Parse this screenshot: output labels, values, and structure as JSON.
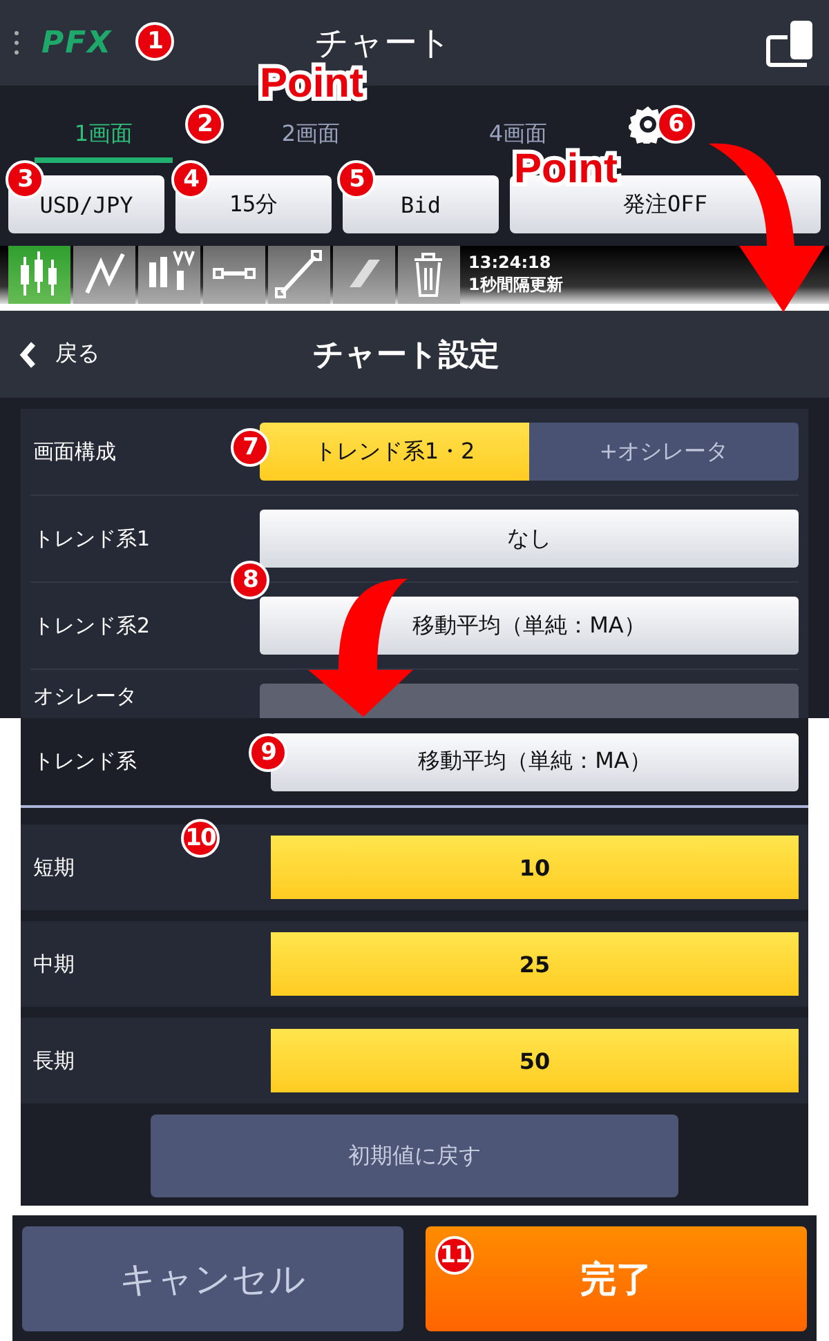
{
  "header": {
    "logo": "PFX",
    "title": "チャート"
  },
  "tabs": [
    {
      "label": "1画面",
      "selected": true
    },
    {
      "label": "2画面",
      "selected": false
    },
    {
      "label": "4画面",
      "selected": false
    }
  ],
  "controls": [
    "USD/JPY",
    "15分",
    "Bid",
    "発注OFF"
  ],
  "toolbar": {
    "tools": [
      {
        "kind": "candles",
        "selected": true
      },
      {
        "kind": "line",
        "selected": false
      },
      {
        "kind": "av",
        "selected": false
      },
      {
        "kind": "segment",
        "selected": false
      },
      {
        "kind": "trendline",
        "selected": false
      },
      {
        "kind": "eraser",
        "selected": false
      },
      {
        "kind": "trash",
        "selected": false
      }
    ],
    "time": "13:24:18",
    "note": "1秒間隔更新"
  },
  "settings": {
    "back": "戻る",
    "title": "チャート設定",
    "rows": [
      {
        "label": "画面構成",
        "kind": "segmented",
        "options": [
          {
            "label": "トレンド系1・2",
            "selected": true
          },
          {
            "label": "+オシレータ",
            "selected": false
          }
        ]
      },
      {
        "label": "トレンド系1",
        "kind": "select",
        "value": "なし"
      },
      {
        "label": "トレンド系2",
        "kind": "select",
        "value": "移動平均（単純：MA）"
      },
      {
        "label": "オシレータ",
        "kind": "disabled"
      }
    ]
  },
  "detail": {
    "label": "トレンド系",
    "value": "移動平均（単純：MA）",
    "periods": [
      {
        "label": "短期",
        "value": "10"
      },
      {
        "label": "中期",
        "value": "25"
      },
      {
        "label": "長期",
        "value": "50"
      }
    ],
    "reset": "初期値に戻す"
  },
  "footer": {
    "cancel": "キャンセル",
    "done": "完了"
  },
  "annotations": {
    "numbers": [
      "1",
      "2",
      "3",
      "4",
      "5",
      "6",
      "7",
      "8",
      "9",
      "10",
      "11"
    ],
    "points": [
      "Point",
      "Point"
    ]
  }
}
